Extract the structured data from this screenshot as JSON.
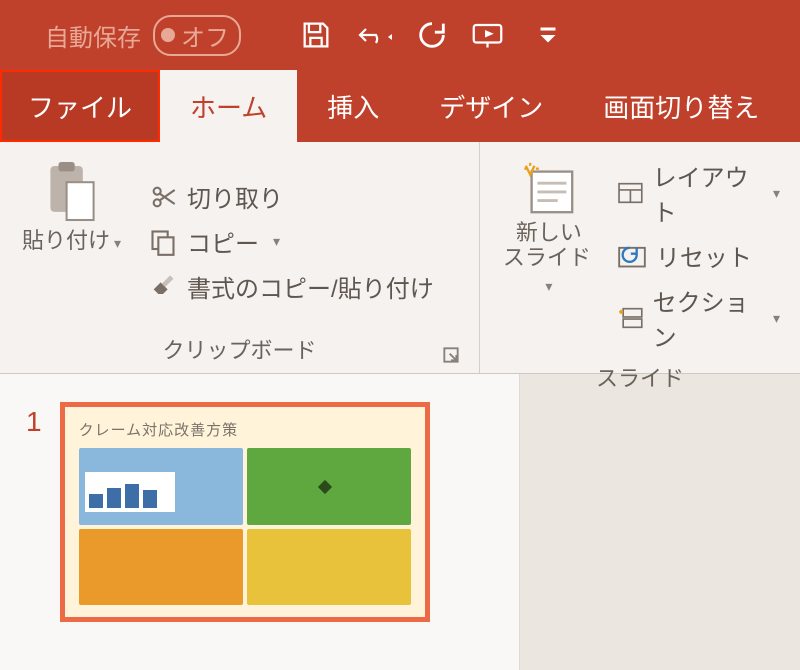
{
  "titlebar": {
    "autosave_label": "自動保存",
    "autosave_state": "オフ"
  },
  "qat": {
    "save": "保存",
    "undo": "元に戻す",
    "redo": "やり直し",
    "present": "最初から開始",
    "customize": "クイックアクセスツールバーのカスタマイズ"
  },
  "tabs": {
    "file": "ファイル",
    "home": "ホーム",
    "insert": "挿入",
    "design": "デザイン",
    "transitions": "画面切り替え"
  },
  "ribbon": {
    "clipboard": {
      "label": "クリップボード",
      "paste": "貼り付け",
      "cut": "切り取り",
      "copy": "コピー",
      "format_painter": "書式のコピー/貼り付け"
    },
    "slides": {
      "label": "スライド",
      "new_slide_line1": "新しい",
      "new_slide_line2": "スライド",
      "layout": "レイアウト",
      "reset": "リセット",
      "section": "セクション"
    }
  },
  "thumbnails": {
    "items": [
      {
        "number": "1",
        "title": "クレーム対応改善方策"
      }
    ]
  }
}
